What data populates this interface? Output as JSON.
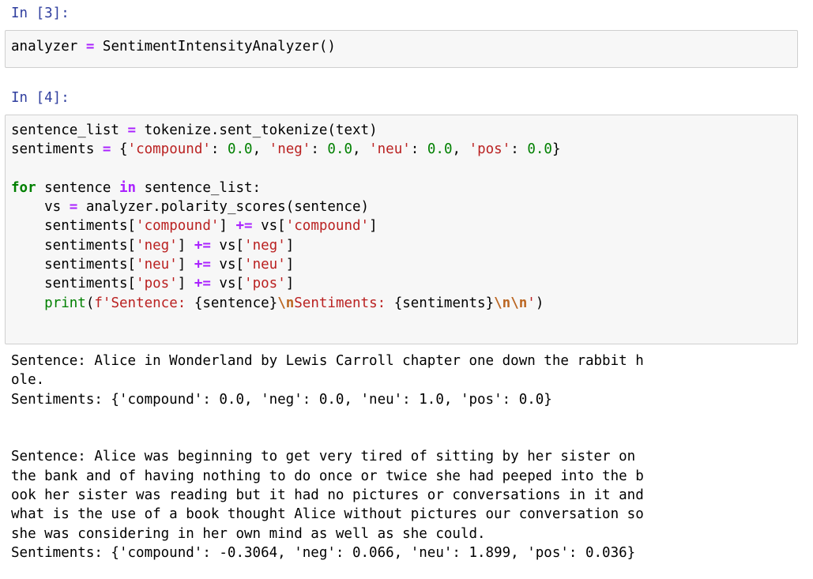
{
  "cells": [
    {
      "prompt": "In [3]:",
      "code": "analyzer = SentimentIntensityAnalyzer()"
    },
    {
      "prompt": "In [4]:",
      "lines": [
        "sentence_list = tokenize.sent_tokenize(text)",
        "sentiments = {'compound': 0.0, 'neg': 0.0, 'neu': 0.0, 'pos': 0.0}",
        "",
        "for sentence in sentence_list:",
        "    vs = analyzer.polarity_scores(sentence)",
        "    sentiments['compound'] += vs['compound']",
        "    sentiments['neg'] += vs['neg']",
        "    sentiments['neu'] += vs['neu']",
        "    sentiments['pos'] += vs['pos']",
        "    print(f'Sentence: {sentence}\\nSentiments: {sentiments}\\n\\n')"
      ]
    }
  ],
  "output_lines": [
    "Sentence: Alice in Wonderland by Lewis Carroll chapter one down the rabbit h",
    "ole.",
    "Sentiments: {'compound': 0.0, 'neg': 0.0, 'neu': 1.0, 'pos': 0.0}",
    "",
    "",
    "Sentence: Alice was beginning to get very tired of sitting by her sister on",
    "the bank and of having nothing to do once or twice she had peeped into the b",
    "ook her sister was reading but it had no pictures or conversations in it and",
    "what is the use of a book thought Alice without pictures our conversation so",
    "she was considering in her own mind as well as she could.",
    "Sentiments: {'compound': -0.3064, 'neg': 0.066, 'neu': 1.899, 'pos': 0.036}"
  ]
}
